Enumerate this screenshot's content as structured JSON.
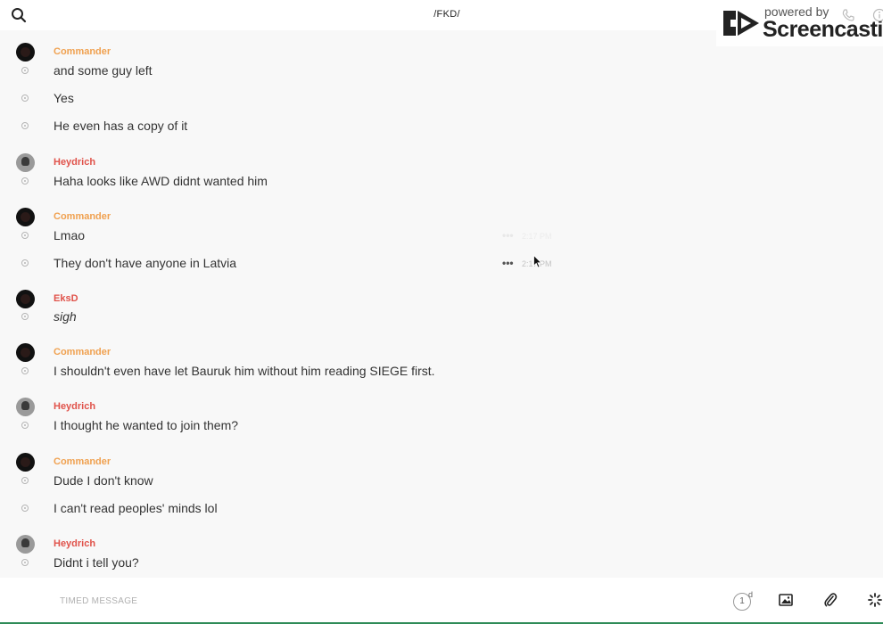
{
  "header": {
    "title": "/FKD/"
  },
  "watermark": {
    "powered": "powered by",
    "brand": "Screencastify"
  },
  "messages": [
    {
      "sender": "Commander",
      "text": "and some guy left"
    },
    {
      "text": "Yes"
    },
    {
      "text": "He even has a copy of it"
    },
    {
      "sender": "Heydrich",
      "text": "Haha looks like AWD didnt wanted him"
    },
    {
      "sender": "Commander",
      "text": "Lmao",
      "time": "2:17 PM"
    },
    {
      "text": "They don't have anyone in Latvia",
      "time": "2:17 PM"
    },
    {
      "sender": "EksD",
      "text": "sigh"
    },
    {
      "sender": "Commander",
      "text": "I shouldn't even have let Bauruk him without him reading SIEGE first."
    },
    {
      "sender": "Heydrich",
      "text": "I thought he wanted to join them?"
    },
    {
      "sender": "Commander",
      "text": "Dude I don't know"
    },
    {
      "text": "I can't read peoples' minds lol"
    },
    {
      "sender": "Heydrich",
      "text": "Didnt i tell you?"
    }
  ],
  "composer": {
    "timed_label": "TIMED MESSAGE",
    "timer_value": "1",
    "timer_unit": "d"
  },
  "colors": {
    "commander": "#f0a150",
    "heydrich": "#e0524a",
    "eksd": "#e0524a"
  },
  "icons": {
    "search": "search-icon",
    "phone": "phone-icon",
    "info": "info-icon",
    "more": "more-icon",
    "image": "image-icon",
    "attach": "paperclip-icon",
    "spinner": "spinner-icon"
  }
}
